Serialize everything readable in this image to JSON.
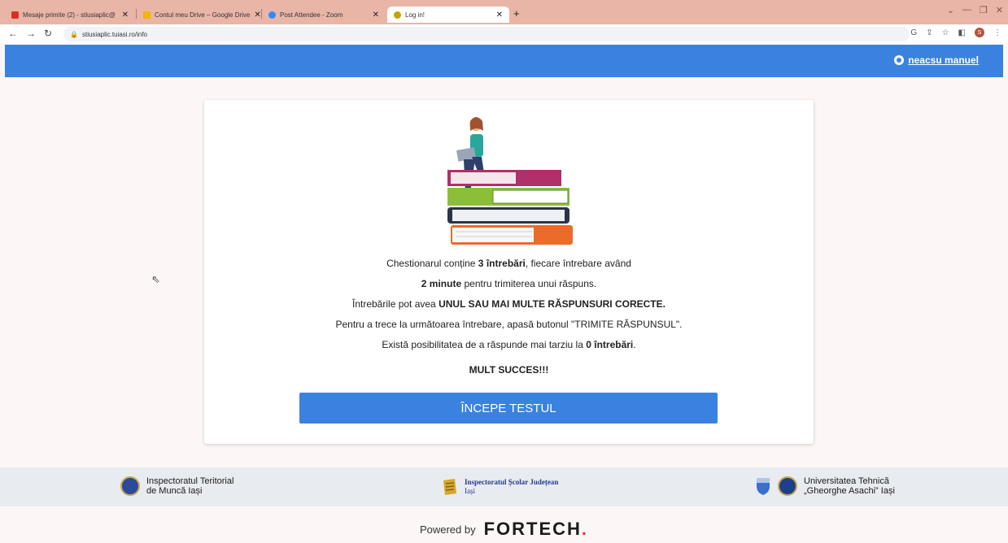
{
  "browser": {
    "tabs": [
      {
        "title": "Mesaje primite (2) - stiusiaplic@",
        "favicon": "gmail-icon",
        "color": "#d93025"
      },
      {
        "title": "Contul meu Drive – Google Drive",
        "favicon": "drive-icon",
        "color": "#f4b400"
      },
      {
        "title": "Post Attendee - Zoom",
        "favicon": "zoom-icon",
        "color": "#2d8cff"
      },
      {
        "title": "Log in!",
        "favicon": "site-icon",
        "color": "#c7a200",
        "active": true
      }
    ],
    "url": "stiusiaplic.tuiasi.ro/info",
    "profile_initial": "S"
  },
  "header": {
    "user_name": "neacsu manuel",
    "bg_color": "#3b82e0"
  },
  "card": {
    "line1_prefix": "Chestionarul conține ",
    "line1_count": "3",
    "line1_bold": "întrebări",
    "line1_suffix": ", fiecare întrebare având",
    "line2_count": "2",
    "line2_bold": "minute",
    "line2_suffix": " pentru trimiterea unui răspuns.",
    "line3_prefix": "Întrebările pot avea ",
    "line3_bold": "UNUL SAU MAI MULTE RĂSPUNSURI CORECTE.",
    "line4": "Pentru a trece la următoarea întrebare, apasă butonul \"TRIMITE RĂSPUNSUL\".",
    "line5_prefix": "Există posibilitatea de a răspunde mai tarziu la ",
    "line5_count": "0",
    "line5_bold": "întrebări",
    "line5_suffix": ".",
    "line6": "MULT SUCCES!!!",
    "start_button": "ÎNCEPE TESTUL"
  },
  "footer": {
    "partner1_line1": "Inspectoratul Teritorial",
    "partner1_line2": "de Muncă Iași",
    "partner2_line1": "Inspectoratul Școlar Județean",
    "partner2_line2": "Iași",
    "partner3_line1": "Universitatea Tehnică",
    "partner3_line2": "„Gheorghe Asachi” Iași",
    "powered_by": "Powered by",
    "brand": "FORTECH",
    "brand_dot": "."
  }
}
